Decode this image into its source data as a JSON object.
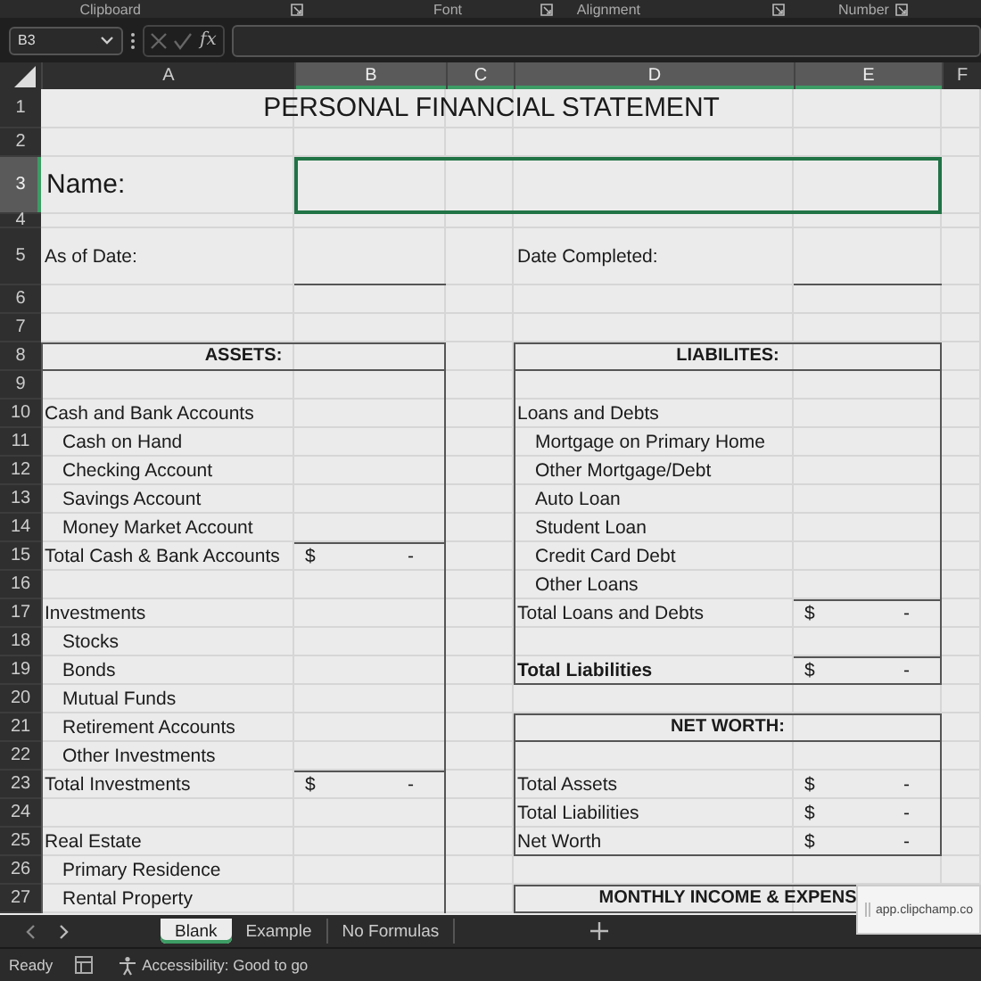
{
  "ribbon_groups": [
    {
      "label": "Clipboard"
    },
    {
      "label": "Font"
    },
    {
      "label": "Alignment"
    },
    {
      "label": "Number"
    }
  ],
  "formula_bar": {
    "name_box": "B3",
    "function_label": "fx"
  },
  "columns": [
    {
      "label": "A",
      "selected": false
    },
    {
      "label": "B",
      "selected": true
    },
    {
      "label": "C",
      "selected": true
    },
    {
      "label": "D",
      "selected": true
    },
    {
      "label": "E",
      "selected": true
    },
    {
      "label": "F",
      "selected": false
    }
  ],
  "rows": [
    {
      "number": "1",
      "selected": false,
      "A": {
        "kind": "title",
        "text": "PERSONAL FINANCIAL STATEMENT"
      }
    },
    {
      "number": "2",
      "selected": false
    },
    {
      "number": "3",
      "selected": true,
      "A": {
        "kind": "name-label",
        "text": "Name:"
      },
      "B": {
        "kind": "field",
        "selected": true
      }
    },
    {
      "number": "4",
      "selected": false
    },
    {
      "number": "5",
      "selected": false,
      "A": {
        "kind": "label",
        "text": "As of Date:"
      },
      "D": {
        "kind": "label",
        "text": "Date Completed:"
      }
    },
    {
      "number": "6",
      "selected": false
    },
    {
      "number": "7",
      "selected": false
    },
    {
      "number": "8",
      "selected": false,
      "A": {
        "kind": "header",
        "text": "ASSETS:"
      },
      "D": {
        "kind": "header",
        "text": "LIABILITES:"
      }
    },
    {
      "number": "9",
      "selected": false
    },
    {
      "number": "10",
      "selected": false,
      "A": {
        "kind": "label",
        "text": "Cash and Bank Accounts"
      },
      "D": {
        "kind": "label",
        "text": "Loans and Debts"
      }
    },
    {
      "number": "11",
      "selected": false,
      "A": {
        "kind": "indent",
        "text": "Cash on Hand"
      },
      "D": {
        "kind": "indent",
        "text": "Mortgage on Primary Home"
      }
    },
    {
      "number": "12",
      "selected": false,
      "A": {
        "kind": "indent",
        "text": "Checking Account"
      },
      "D": {
        "kind": "indent",
        "text": "Other Mortgage/Debt"
      }
    },
    {
      "number": "13",
      "selected": false,
      "A": {
        "kind": "indent",
        "text": "Savings Account"
      },
      "D": {
        "kind": "indent",
        "text": "Auto Loan"
      }
    },
    {
      "number": "14",
      "selected": false,
      "A": {
        "kind": "indent",
        "text": "Money Market Account"
      },
      "D": {
        "kind": "indent",
        "text": "Student Loan"
      }
    },
    {
      "number": "15",
      "selected": false,
      "A": {
        "kind": "label",
        "text": "Total Cash & Bank Accounts"
      },
      "B": {
        "kind": "amount",
        "currency": "$",
        "value": "-"
      },
      "D": {
        "kind": "indent",
        "text": "Credit Card Debt"
      }
    },
    {
      "number": "16",
      "selected": false,
      "D": {
        "kind": "indent",
        "text": "Other Loans"
      }
    },
    {
      "number": "17",
      "selected": false,
      "A": {
        "kind": "label",
        "text": "Investments"
      },
      "D": {
        "kind": "label",
        "text": "Total Loans and Debts"
      },
      "E": {
        "kind": "amount",
        "currency": "$",
        "value": "-"
      }
    },
    {
      "number": "18",
      "selected": false,
      "A": {
        "kind": "indent",
        "text": "Stocks"
      }
    },
    {
      "number": "19",
      "selected": false,
      "A": {
        "kind": "indent",
        "text": "Bonds"
      },
      "D": {
        "kind": "bold",
        "text": "Total Liabilities"
      },
      "E": {
        "kind": "amount",
        "currency": "$",
        "value": "-"
      }
    },
    {
      "number": "20",
      "selected": false,
      "A": {
        "kind": "indent",
        "text": "Mutual Funds"
      }
    },
    {
      "number": "21",
      "selected": false,
      "A": {
        "kind": "indent",
        "text": "Retirement Accounts"
      },
      "D": {
        "kind": "header",
        "text": "NET WORTH:"
      }
    },
    {
      "number": "22",
      "selected": false,
      "A": {
        "kind": "indent",
        "text": "Other Investments"
      }
    },
    {
      "number": "23",
      "selected": false,
      "A": {
        "kind": "label",
        "text": "Total Investments"
      },
      "B": {
        "kind": "amount",
        "currency": "$",
        "value": "-"
      },
      "D": {
        "kind": "label",
        "text": "Total Assets"
      },
      "E": {
        "kind": "amount",
        "currency": "$",
        "value": "-"
      }
    },
    {
      "number": "24",
      "selected": false,
      "D": {
        "kind": "label",
        "text": "Total Liabilities"
      },
      "E": {
        "kind": "amount",
        "currency": "$",
        "value": "-"
      }
    },
    {
      "number": "25",
      "selected": false,
      "A": {
        "kind": "label",
        "text": "Real Estate"
      },
      "D": {
        "kind": "label",
        "text": "Net Worth"
      },
      "E": {
        "kind": "amount",
        "currency": "$",
        "value": "-"
      }
    },
    {
      "number": "26",
      "selected": false,
      "A": {
        "kind": "indent",
        "text": "Primary Residence"
      }
    },
    {
      "number": "27",
      "selected": false,
      "A": {
        "kind": "indent",
        "text": "Rental Property"
      },
      "D": {
        "kind": "header",
        "text": "MONTHLY INCOME & EXPENS"
      }
    }
  ],
  "sheet_tabs": [
    {
      "label": "Blank",
      "selected": true
    },
    {
      "label": "Example",
      "selected": false
    },
    {
      "label": "No Formulas",
      "selected": false
    }
  ],
  "status_bar": {
    "status": "Ready",
    "accessibility": "Accessibility: Good to go"
  },
  "toast": {
    "text": "app.clipchamp.co"
  }
}
